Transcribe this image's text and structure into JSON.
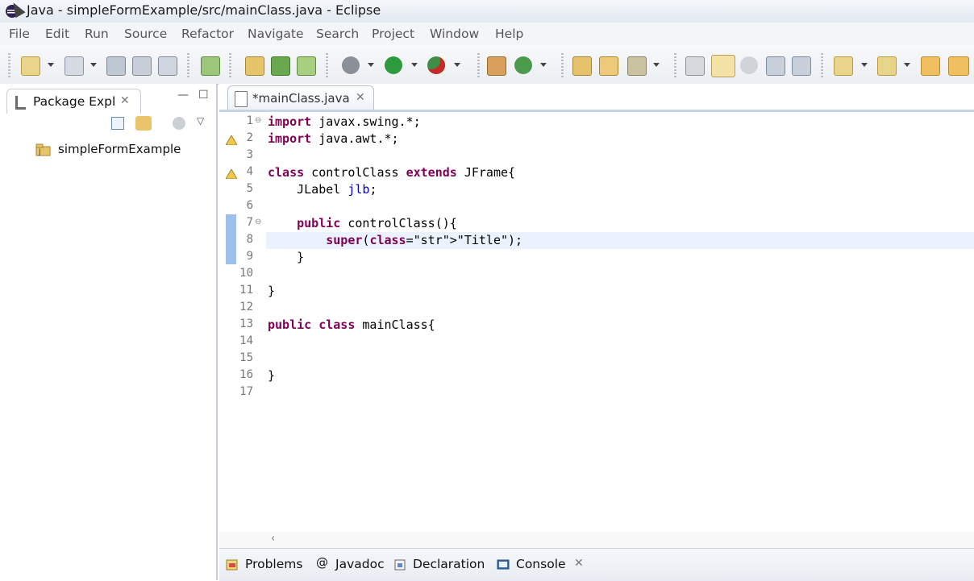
{
  "window": {
    "title": "Java - simpleFormExample/src/mainClass.java - Eclipse"
  },
  "menu": [
    "File",
    "Edit",
    "Run",
    "Source",
    "Refactor",
    "Navigate",
    "Search",
    "Project",
    "Window",
    "Help"
  ],
  "left_panel": {
    "tab_label": "Package Expl",
    "tree": [
      {
        "label": "simpleFormExample"
      }
    ]
  },
  "editor": {
    "tab_label": "*mainClass.java",
    "lines": [
      {
        "n": "1",
        "text": "import javax.swing.*;"
      },
      {
        "n": "2",
        "text": "import java.awt.*;"
      },
      {
        "n": "3",
        "text": ""
      },
      {
        "n": "4",
        "text": "class controlClass extends JFrame{"
      },
      {
        "n": "5",
        "text": "    JLabel jlb;"
      },
      {
        "n": "6",
        "text": ""
      },
      {
        "n": "7",
        "text": "    public controlClass(){"
      },
      {
        "n": "8",
        "text": "        super(\"Title\");"
      },
      {
        "n": "9",
        "text": "    }"
      },
      {
        "n": "10",
        "text": ""
      },
      {
        "n": "11",
        "text": "}"
      },
      {
        "n": "12",
        "text": ""
      },
      {
        "n": "13",
        "text": "public class mainClass{"
      },
      {
        "n": "14",
        "text": ""
      },
      {
        "n": "15",
        "text": ""
      },
      {
        "n": "16",
        "text": "}"
      },
      {
        "n": "17",
        "text": ""
      }
    ]
  },
  "bottom_tabs": [
    "Problems",
    "Javadoc",
    "Declaration",
    "Console"
  ],
  "colors": {
    "keyword": "#7f0055",
    "string": "#2a00ff",
    "field": "#0000c0",
    "current_line": "#e9f2fd"
  }
}
